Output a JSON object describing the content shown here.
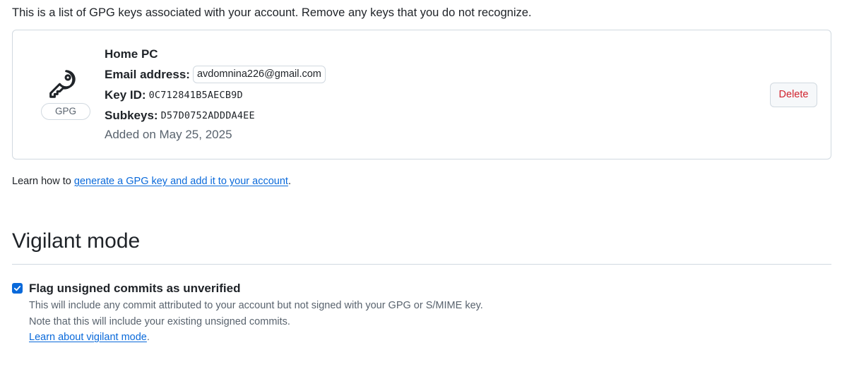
{
  "intro_text": "This is a list of GPG keys associated with your account. Remove any keys that you do not recognize.",
  "key": {
    "icon": "key-icon",
    "badge": "GPG",
    "name": "Home PC",
    "email_label": "Email address:",
    "email": "avdomnina226@gmail.com",
    "key_id_label": "Key ID:",
    "key_id": "0C712841B5AECB9D",
    "subkeys_label": "Subkeys:",
    "subkeys": "D57D0752ADDDA4EE",
    "added_on": "Added on May 25, 2025",
    "delete_label": "Delete"
  },
  "learn": {
    "prefix": "Learn how to ",
    "link": "generate a GPG key and add it to your account",
    "suffix": "."
  },
  "vigilant": {
    "title": "Vigilant mode",
    "checkbox_label": "Flag unsigned commits as unverified",
    "checked": true,
    "note1": "This will include any commit attributed to your account but not signed with your GPG or S/MIME key.",
    "note2": "Note that this will include your existing unsigned commits.",
    "link": "Learn about vigilant mode",
    "link_suffix": "."
  },
  "colors": {
    "accent": "#0969da",
    "danger": "#d1242f",
    "border": "#d1d9e0",
    "muted": "#59636e"
  }
}
